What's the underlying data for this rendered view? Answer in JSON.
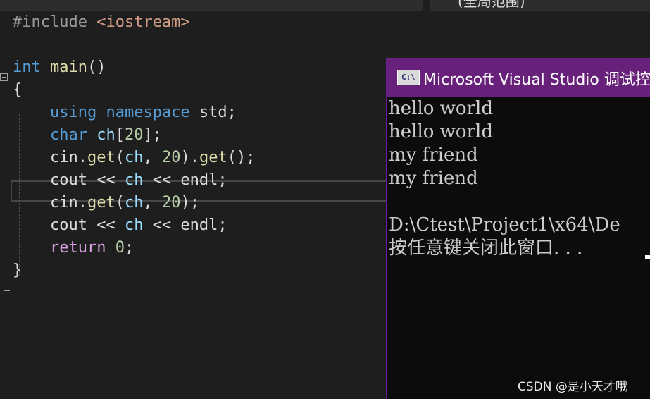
{
  "toolbar": {
    "scope_label": "(全局范围)"
  },
  "editor": {
    "lines": [
      [
        [
          "pp",
          "#include "
        ],
        [
          "str",
          "<iostream>"
        ]
      ],
      [],
      [
        [
          "kw",
          "int "
        ],
        [
          "fn",
          "main"
        ],
        [
          "def",
          "()"
        ]
      ],
      [
        [
          "def",
          "{"
        ]
      ],
      [
        [
          "def",
          "    "
        ],
        [
          "kw",
          "using "
        ],
        [
          "kw",
          "namespace "
        ],
        [
          "def",
          "std;"
        ]
      ],
      [
        [
          "def",
          "    "
        ],
        [
          "ty",
          "char "
        ],
        [
          "var",
          "ch"
        ],
        [
          "def",
          "["
        ],
        [
          "num",
          "20"
        ],
        [
          "def",
          "];"
        ]
      ],
      [
        [
          "def",
          "    cin."
        ],
        [
          "fn",
          "get"
        ],
        [
          "def",
          "("
        ],
        [
          "var",
          "ch"
        ],
        [
          "def",
          ", "
        ],
        [
          "num",
          "20"
        ],
        [
          "def",
          ")."
        ],
        [
          "fn",
          "get"
        ],
        [
          "def",
          "();"
        ]
      ],
      [
        [
          "def",
          "    cout << "
        ],
        [
          "var",
          "ch"
        ],
        [
          "def",
          " << endl;"
        ]
      ],
      [
        [
          "def",
          "    cin."
        ],
        [
          "fn",
          "get"
        ],
        [
          "def",
          "("
        ],
        [
          "var",
          "ch"
        ],
        [
          "def",
          ", "
        ],
        [
          "num",
          "20"
        ],
        [
          "def",
          ");"
        ]
      ],
      [
        [
          "def",
          "    cout << "
        ],
        [
          "var",
          "ch"
        ],
        [
          "def",
          " << endl;"
        ]
      ],
      [
        [
          "def",
          "    "
        ],
        [
          "ret",
          "return "
        ],
        [
          "num",
          "0"
        ],
        [
          "def",
          ";"
        ]
      ],
      [
        [
          "def",
          "}"
        ]
      ]
    ]
  },
  "console": {
    "title": "Microsoft Visual Studio 调试控",
    "icon_text": "C:\\",
    "output": [
      "hello world",
      "hello world",
      "my friend",
      "my friend",
      "",
      "D:\\Ctest\\Project1\\x64\\De",
      "按任意键关闭此窗口. . ."
    ]
  },
  "watermark": "CSDN @是小天才哦",
  "colors": {
    "editor_bg": "#1e1e1e",
    "keyword": "#569cd6",
    "function": "#dcdcaa",
    "number": "#b5cea8",
    "string": "#d69d85",
    "console_title_bg": "#68217a",
    "console_bg": "#0c0c0c"
  }
}
